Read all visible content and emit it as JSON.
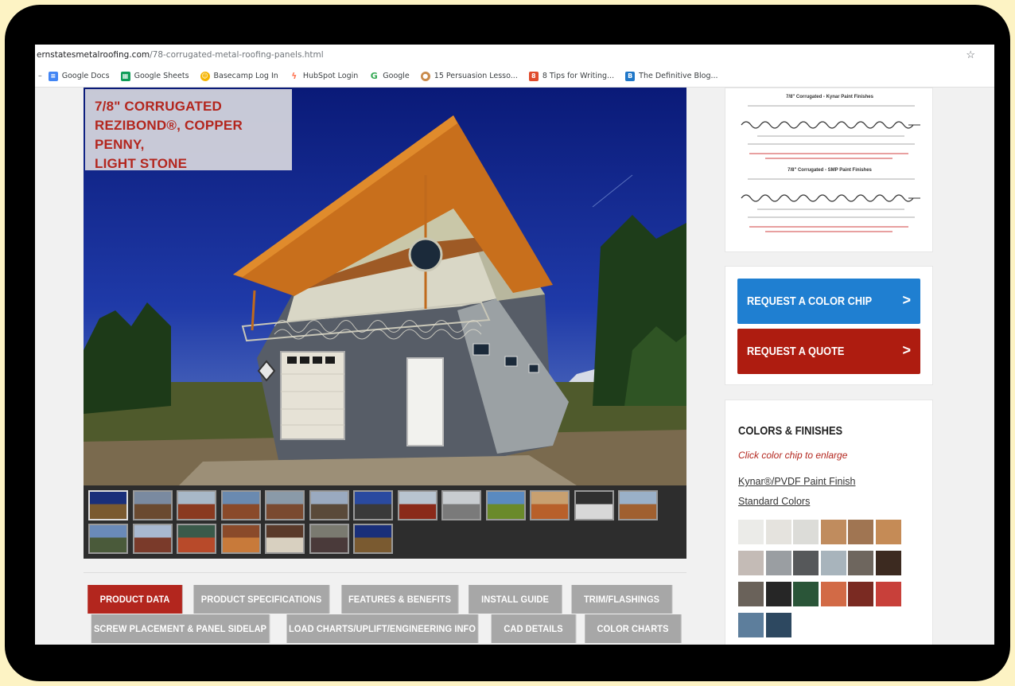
{
  "browser": {
    "url_domain": "ernstatesmetalroofing.com",
    "url_path": "/78-corrugated-metal-roofing-panels.html",
    "star_icon": "star-icon",
    "bookmarks": [
      {
        "label": "Google Docs",
        "color": "#4285f4"
      },
      {
        "label": "Google Sheets",
        "color": "#0f9d58"
      },
      {
        "label": "Basecamp Log In",
        "color": "#f5b400"
      },
      {
        "label": "HubSpot Login",
        "color": "#ff7a59"
      },
      {
        "label": "Google",
        "color": "#34a853"
      },
      {
        "label": "15 Persuasion Lesso...",
        "color": "#c98a4a"
      },
      {
        "label": "8 Tips for Writing...",
        "color": "#e04b2c"
      },
      {
        "label": "The Definitive Blog...",
        "color": "#1f77c8"
      }
    ]
  },
  "gallery": {
    "caption_lines": [
      "7/8\" CORRUGATED",
      "REZIBOND®, COPPER PENNY,",
      "LIGHT STONE"
    ],
    "thumbnail_count": 20
  },
  "tabs": {
    "row1": [
      "PRODUCT DATA",
      "PRODUCT SPECIFICATIONS",
      "FEATURES & BENEFITS",
      "INSTALL GUIDE",
      "TRIM/FLASHINGS"
    ],
    "row2": [
      "SCREW PLACEMENT & PANEL SIDELAP",
      "LOAD CHARTS/UPLIFT/ENGINEERING INFO",
      "CAD DETAILS",
      "COLOR CHARTS"
    ],
    "active": "PRODUCT DATA"
  },
  "sidebar": {
    "diagram_title_1": "7/8\" Corrugated - Kynar Paint Finishes",
    "diagram_title_2": "7/8\" Corrugated - SMP Paint Finishes",
    "request_chip_label": "REQUEST A COLOR CHIP",
    "request_quote_label": "REQUEST A QUOTE",
    "chevron_icon": "chevron-right-icon",
    "colors_title": "COLORS & FINISHES",
    "colors_subtitle": "Click color chip to enlarge",
    "kynar_link": "Kynar®/PVDF Paint Finish",
    "standard_colors_link": "Standard Colors",
    "swatches": [
      "#ebebe8",
      "#e5e3de",
      "#dcdcd8",
      "#c08c5e",
      "#a07552",
      "#c58b56",
      "#c4bbb6",
      "#9a9ea2",
      "#56585a",
      "#a8b4bc",
      "#6e665e",
      "#3c2a20",
      "#6a625a",
      "#262626",
      "#2a5538",
      "#d26a46",
      "#7a2a22",
      "#c8403a",
      "#5d7e9c",
      "#2d4860"
    ]
  }
}
